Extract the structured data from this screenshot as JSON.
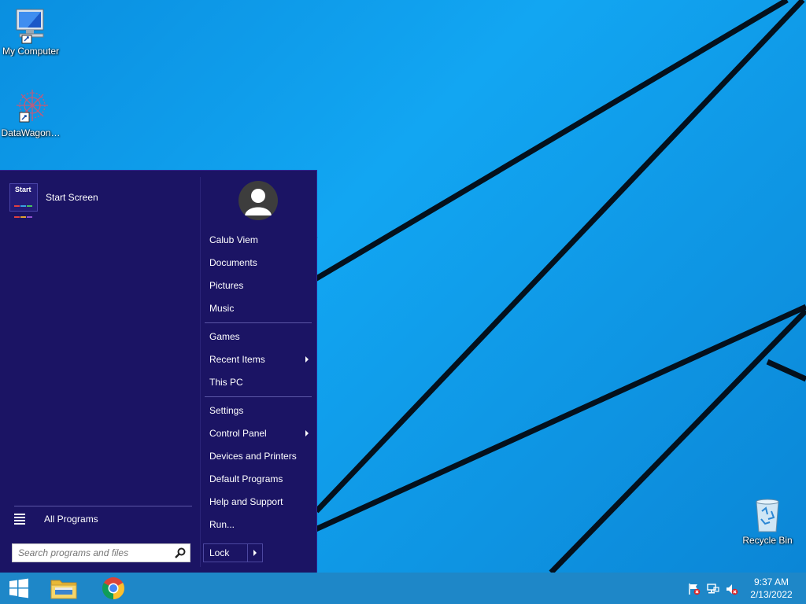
{
  "desktop": {
    "icons": [
      {
        "label": "My Computer",
        "icon": "computer-icon"
      },
      {
        "label": "DataWagon…",
        "icon": "datawagon-icon"
      },
      {
        "label": "Recycle Bin",
        "icon": "recycle-bin-icon"
      }
    ]
  },
  "start_menu": {
    "pinned": [
      {
        "label": "Start Screen",
        "tile_label": "Start",
        "icon": "start-screen-tile-icon"
      }
    ],
    "all_programs": {
      "label": "All Programs",
      "icon": "list-icon"
    },
    "search": {
      "placeholder": "Search programs and files",
      "icon": "search-icon"
    },
    "user_icon": "user-avatar-icon",
    "right_items": [
      {
        "label": "Calub Viem"
      },
      {
        "label": "Documents"
      },
      {
        "label": "Pictures"
      },
      {
        "label": "Music"
      },
      {
        "label": "Games"
      },
      {
        "label": "Recent Items",
        "has_submenu": true
      },
      {
        "label": "This PC"
      },
      {
        "label": "Settings"
      },
      {
        "label": "Control Panel",
        "has_submenu": true
      },
      {
        "label": "Devices and Printers"
      },
      {
        "label": "Default Programs"
      },
      {
        "label": "Help and Support"
      },
      {
        "label": "Run..."
      }
    ],
    "lock": {
      "label": "Lock",
      "icon": "chevron-right-icon"
    }
  },
  "taskbar": {
    "buttons": [
      {
        "name": "start",
        "icon": "windows-logo-icon"
      },
      {
        "name": "file-explorer",
        "icon": "folder-icon"
      },
      {
        "name": "chrome",
        "icon": "chrome-icon"
      }
    ],
    "tray_icons": [
      "action-center-flag-icon",
      "network-icon",
      "volume-muted-icon"
    ],
    "clock": {
      "time": "9:37 AM",
      "date": "2/13/2022"
    }
  },
  "colors": {
    "desktop_blue": "#12a6f2",
    "start_menu_bg": "#1b1464",
    "taskbar": "#1e87c8"
  }
}
